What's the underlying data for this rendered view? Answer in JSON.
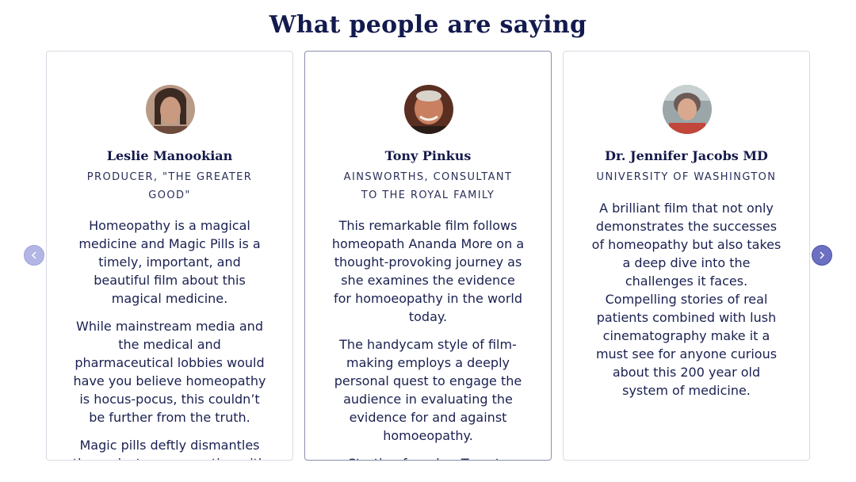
{
  "heading": "What people are saying",
  "carousel": {
    "prev_icon": "chevron-left-icon",
    "next_icon": "chevron-right-icon",
    "colors": {
      "prev": "#b3b6e4",
      "next": "#6c70c2",
      "text": "#1b1f4b"
    }
  },
  "testimonials": [
    {
      "name": "Leslie Manookian",
      "role": "PRODUCER, \"THE GREATER GOOD\"",
      "paragraphs": [
        "Homeopathy is a magical medicine and Magic Pills is a timely, important, and beautiful film about this magical medicine.",
        "While mainstream media and the medical and pharmaceutical lobbies would have you believe homeopathy is hocus-pocus, this couldn’t be further from the truth.",
        "Magic pills deftly dismantles the mainstream narrative with"
      ]
    },
    {
      "name": "Tony Pinkus",
      "role": "AINSWORTHS, CONSULTANT TO THE ROYAL FAMILY",
      "paragraphs": [
        "This remarkable film follows homeopath Ananda More on a thought-provoking journey as she examines the evidence for homoeopathy in the world today.",
        "The handycam style of film-making employs a deeply personal quest to engage the audience in evaluating the evidence for and against homoeopathy.",
        "Starting from her Toronto"
      ]
    },
    {
      "name": "Dr. Jennifer Jacobs MD",
      "role": "UNIVERSITY OF WASHINGTON",
      "paragraphs": [
        "A brilliant film that not only demonstrates the successes of homeopathy but also takes a deep dive into the challenges it faces. Compelling stories of real patients combined with lush cinematography make it a must see for anyone curious about this 200 year old system of medicine."
      ]
    }
  ]
}
